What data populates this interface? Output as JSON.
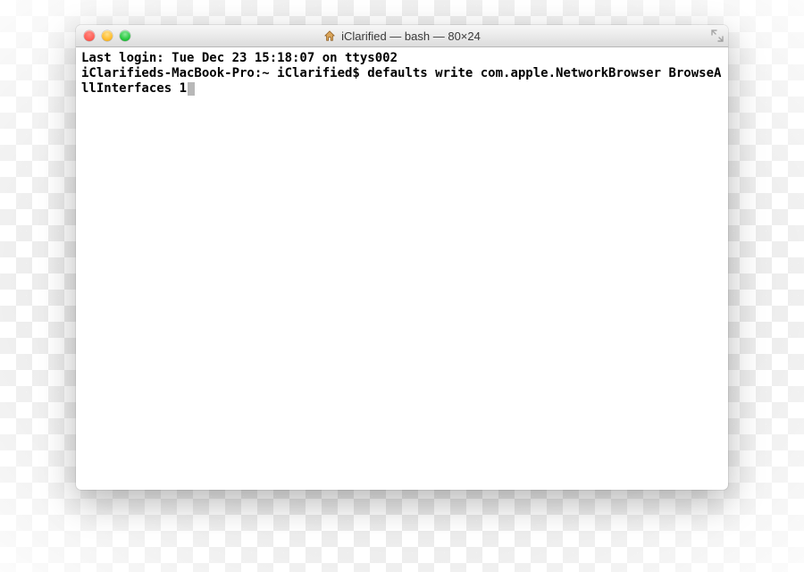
{
  "window": {
    "title": "iClarified — bash — 80×24"
  },
  "terminal": {
    "last_login": "Last login: Tue Dec 23 15:18:07 on ttys002",
    "prompt": "iClarifieds-MacBook-Pro:~ iClarified$ ",
    "command": "defaults write com.apple.NetworkBrowser BrowseAllInterfaces 1"
  }
}
